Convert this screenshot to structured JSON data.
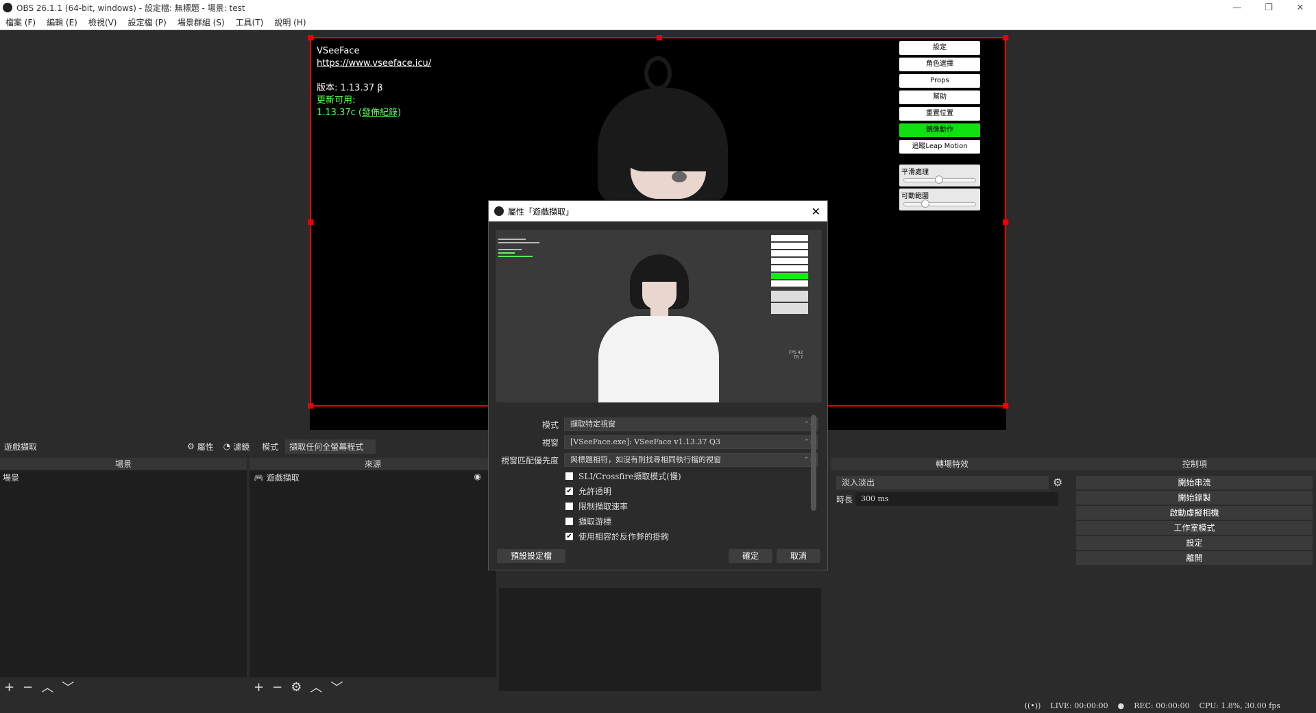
{
  "window": {
    "title": "OBS 26.1.1 (64-bit, windows) - 設定檔: 無標題 - 場景: test",
    "min": "—",
    "max": "❐",
    "close": "✕"
  },
  "menu": [
    "檔案 (F)",
    "編輯 (E)",
    "檢視(V)",
    "設定檔 (P)",
    "場景群組 (S)",
    "工具(T)",
    "說明 (H)"
  ],
  "vseeface": {
    "name": "VSeeFace",
    "url": "https://www.vseeface.icu/",
    "version": "版本: 1.13.37 β",
    "update_label": "更新可用:",
    "update_version": "1.13.37c (",
    "update_link": "發佈紀錄",
    "update_close": ")",
    "buttons": [
      "設定",
      "角色選擇",
      "Props",
      "幫助",
      "重置位置",
      "鏡像動作",
      "追蹤Leap Motion"
    ],
    "sliders": [
      {
        "label": "平滑處理",
        "value": 0.5
      },
      {
        "label": "可動範圍",
        "value": 0.3
      }
    ]
  },
  "source_toolbar": {
    "source_name": "遊戲擷取",
    "properties": "屬性",
    "filters": "濾鏡",
    "mode_label": "模式",
    "mode_value": "擷取任何全螢幕程式"
  },
  "docks": {
    "scenes": {
      "title": "場景",
      "items": [
        "場景"
      ]
    },
    "sources": {
      "title": "來源",
      "items": [
        "遊戲擷取"
      ]
    },
    "transitions": {
      "title": "轉場特效",
      "effect": "淡入淡出",
      "duration_label": "時長",
      "duration_value": "300 ms"
    },
    "controls": {
      "title": "控制項",
      "buttons": [
        "開始串流",
        "開始錄製",
        "啟動虛擬相機",
        "工作室模式",
        "設定",
        "離開"
      ]
    }
  },
  "status": {
    "live": "LIVE: 00:00:00",
    "rec": "REC: 00:00:00",
    "cpu": "CPU: 1.8%, 30.00 fps"
  },
  "dialog": {
    "title": "屬性「遊戲擷取」",
    "fields": [
      {
        "label": "模式",
        "value": "擷取特定視窗"
      },
      {
        "label": "視窗",
        "value": "[VSeeFace.exe]: VSeeFace v1.13.37 Q3"
      },
      {
        "label": "視窗匹配優先度",
        "value": "與標題相符，如沒有則找尋相同執行檔的視窗"
      }
    ],
    "checkboxes": [
      {
        "label": "SLI/Crossfire擷取模式(慢)",
        "checked": false
      },
      {
        "label": "允許透明",
        "checked": true
      },
      {
        "label": "限制擷取速率",
        "checked": false
      },
      {
        "label": "擷取游標",
        "checked": false
      },
      {
        "label": "使用相容於反作弊的掛鉤",
        "checked": true
      }
    ],
    "defaults_button": "預設設定檔",
    "ok_button": "確定",
    "cancel_button": "取消",
    "fps_text": "FPS 42",
    "tr_text": "TR 7"
  }
}
